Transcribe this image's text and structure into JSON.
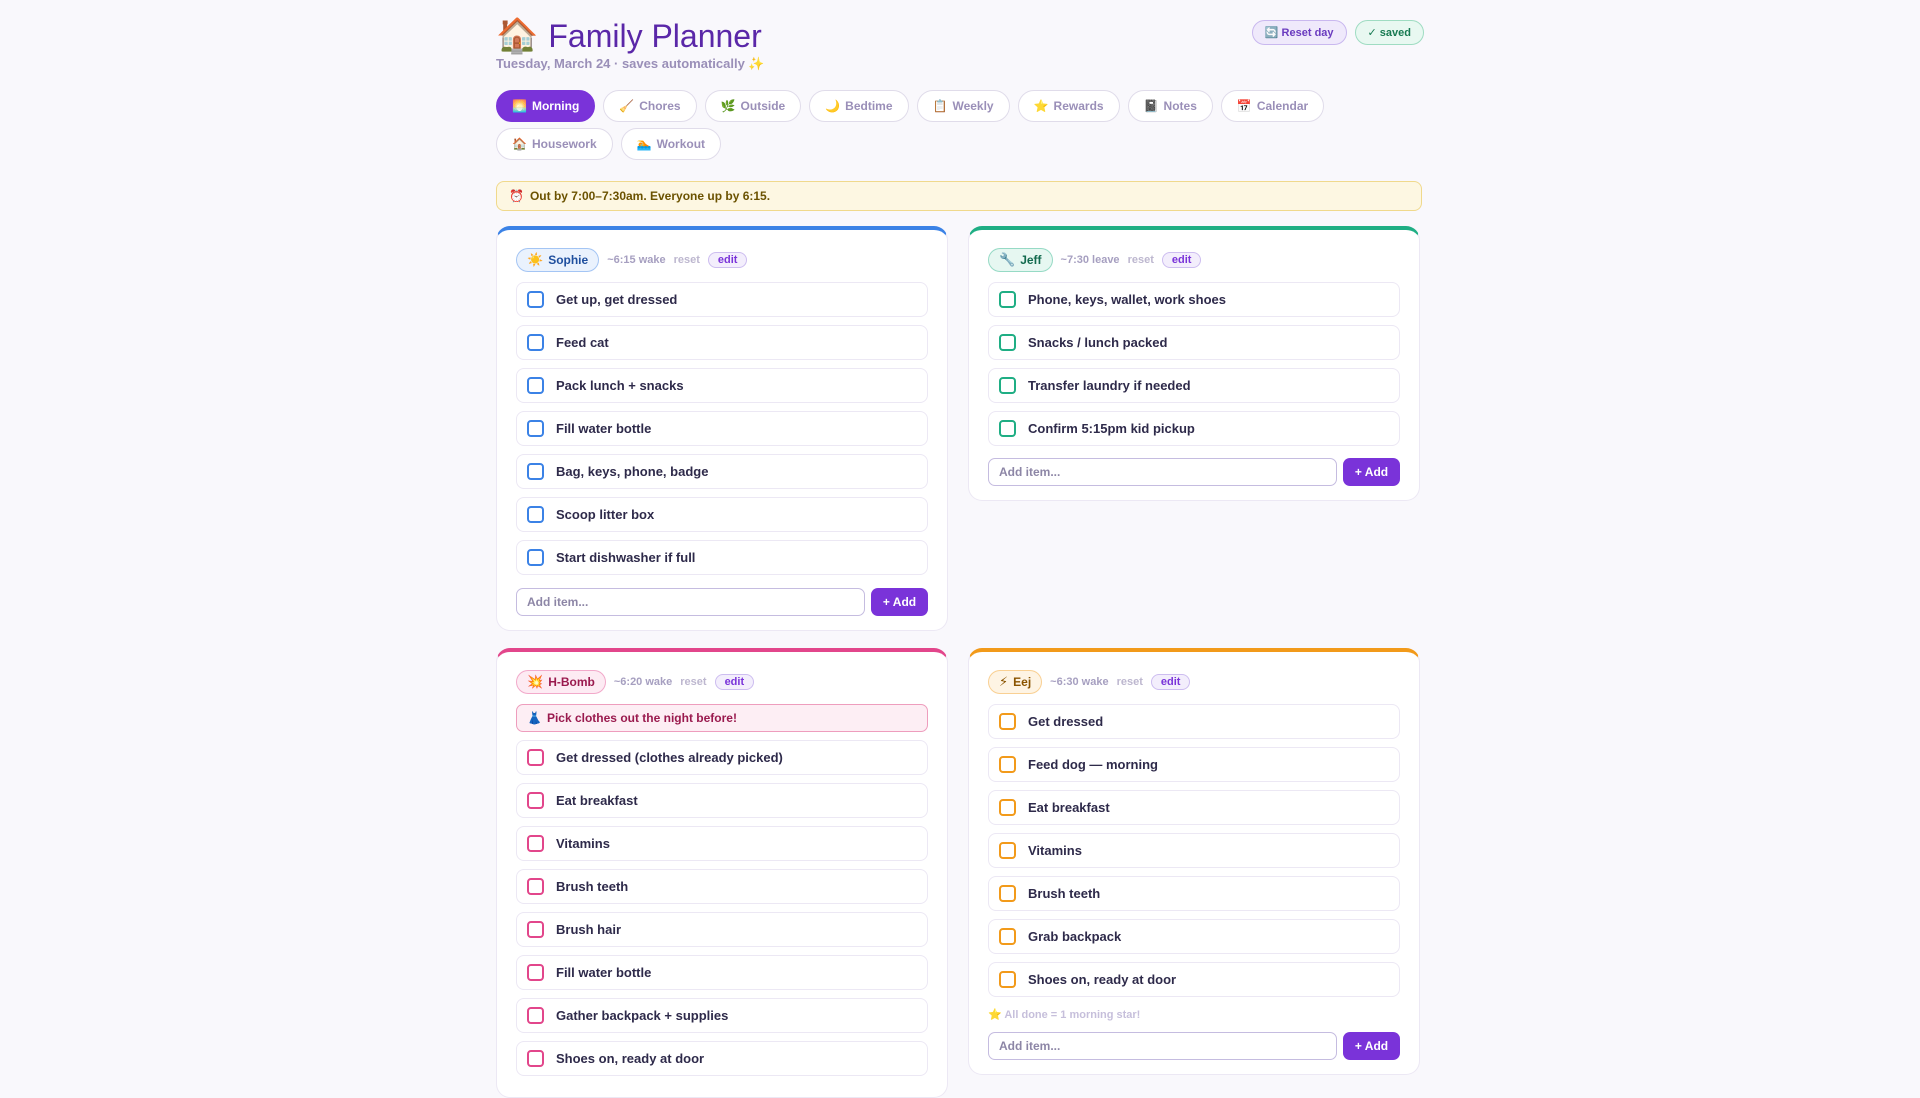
{
  "app": {
    "emoji": "🏠",
    "title": "Family Planner",
    "subtitle": "Tuesday, March 24 · saves automatically ✨"
  },
  "actions": {
    "reset_day": "🔄 Reset day",
    "saved": "✓ saved"
  },
  "tabs": [
    {
      "icon": "🌅",
      "label": "Morning",
      "active": true
    },
    {
      "icon": "🧹",
      "label": "Chores"
    },
    {
      "icon": "🌿",
      "label": "Outside"
    },
    {
      "icon": "🌙",
      "label": "Bedtime"
    },
    {
      "icon": "📋",
      "label": "Weekly"
    },
    {
      "icon": "⭐",
      "label": "Rewards"
    },
    {
      "icon": "📓",
      "label": "Notes"
    },
    {
      "icon": "📅",
      "label": "Calendar"
    },
    {
      "icon": "🏠",
      "label": "Housework"
    },
    {
      "icon": "🏊",
      "label": "Workout"
    }
  ],
  "notice": {
    "icon": "⏰",
    "text": "Out by 7:00–7:30am. Everyone up by 6:15."
  },
  "colors": {
    "sophie": "#3b82e6",
    "jeff": "#1fae84",
    "hbomb": "#e2468b",
    "eej": "#f29a1a",
    "accent": "#7a33d9"
  },
  "cards": {
    "sophie": {
      "icon": "☀️",
      "name": "Sophie",
      "meta": "~6:15 wake",
      "reset": "reset",
      "edit": "edit",
      "items": [
        "Get up, get dressed",
        "Feed cat",
        "Pack lunch + snacks",
        "Fill water bottle",
        "Bag, keys, phone, badge",
        "Scoop litter box",
        "Start dishwasher if full"
      ],
      "add_placeholder": "Add item...",
      "add_label": "+ Add"
    },
    "jeff": {
      "icon": "🔧",
      "name": "Jeff",
      "meta": "~7:30 leave",
      "reset": "reset",
      "edit": "edit",
      "items": [
        "Phone, keys, wallet, work shoes",
        "Snacks / lunch packed",
        "Transfer laundry if needed",
        "Confirm 5:15pm kid pickup"
      ],
      "add_placeholder": "Add item...",
      "add_label": "+ Add"
    },
    "hbomb": {
      "icon": "💥",
      "name": "H-Bomb",
      "meta": "~6:20 wake",
      "reset": "reset",
      "edit": "edit",
      "tip": {
        "icon": "👗",
        "text": "Pick clothes out the night before!"
      },
      "items": [
        "Get dressed (clothes already picked)",
        "Eat breakfast",
        "Vitamins",
        "Brush teeth",
        "Brush hair",
        "Fill water bottle",
        "Gather backpack + supplies",
        "Shoes on, ready at door"
      ]
    },
    "eej": {
      "icon": "⚡",
      "name": "Eej",
      "meta": "~6:30 wake",
      "reset": "reset",
      "edit": "edit",
      "items": [
        "Get dressed",
        "Feed dog — morning",
        "Eat breakfast",
        "Vitamins",
        "Brush teeth",
        "Grab backpack",
        "Shoes on, ready at door"
      ],
      "star_note": {
        "icon": "⭐",
        "text": "All done = 1 morning star!"
      },
      "add_placeholder": "Add item...",
      "add_label": "+ Add"
    }
  }
}
